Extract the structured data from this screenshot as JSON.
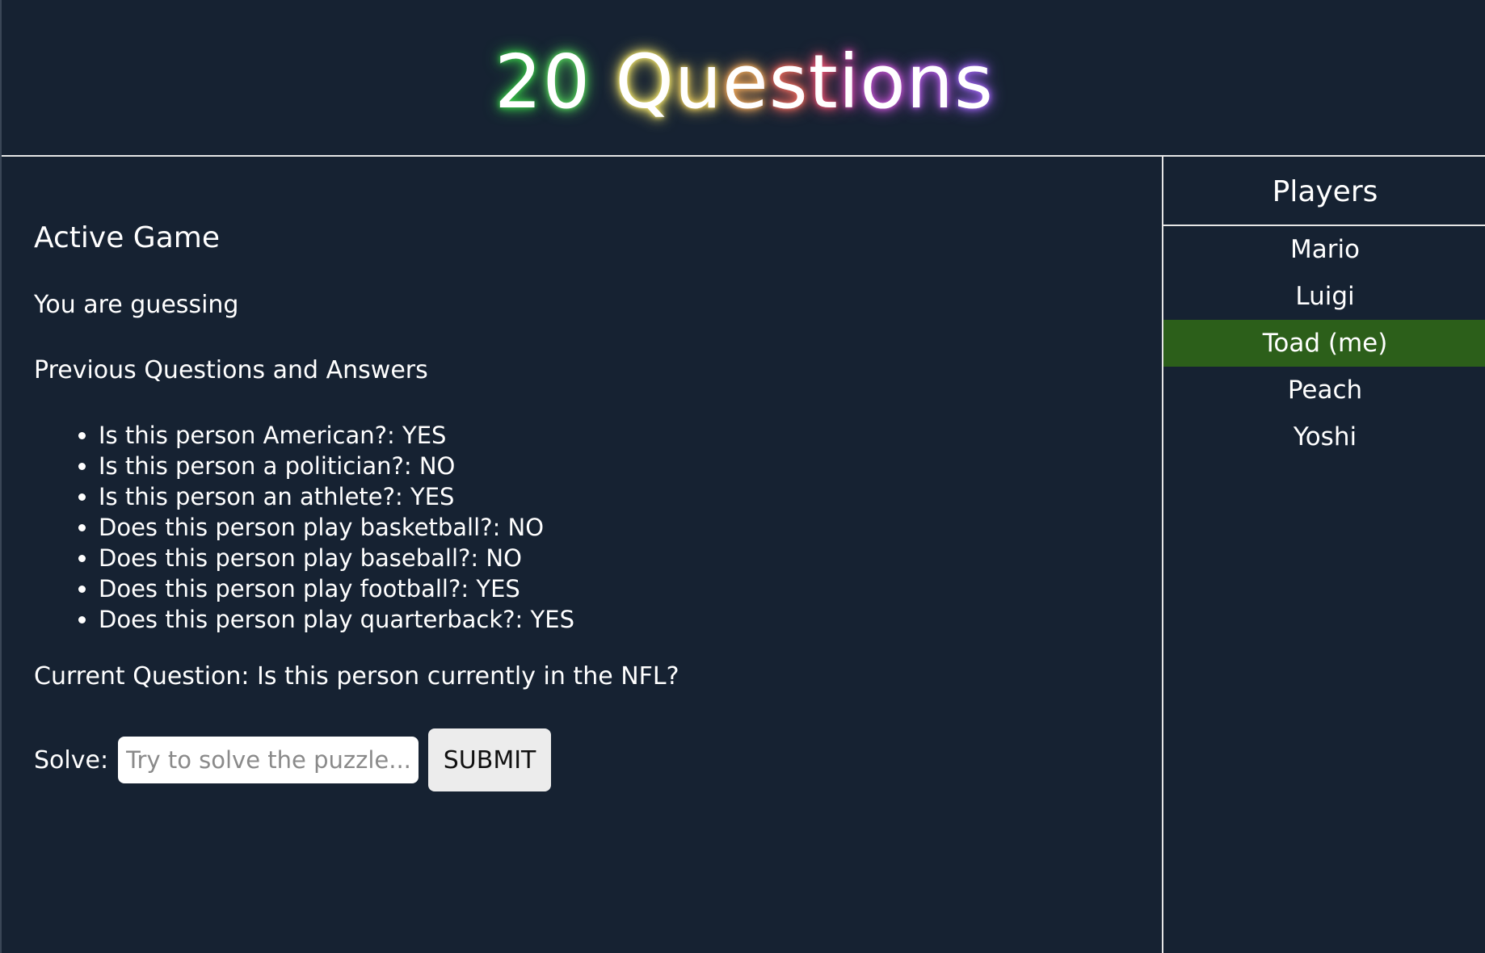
{
  "header": {
    "title_chars": [
      "2",
      "0",
      " ",
      "Q",
      "u",
      "e",
      "s",
      "t",
      "i",
      "o",
      "n",
      "s"
    ],
    "glow_colors": [
      "#38c548",
      "#53d05a",
      "#ffffff",
      "#f3e56b",
      "#f2d35f",
      "#f0a85a",
      "#ee6a5d",
      "#e45271",
      "#d14aa9",
      "#c454d3",
      "#b15ae1",
      "#9f63f0"
    ]
  },
  "main": {
    "section_title": "Active Game",
    "role_text": "You are guessing",
    "prev_title": "Previous Questions and Answers",
    "qa": [
      "Is this person American?: YES",
      "Is this person a politician?: NO",
      "Is this person an athlete?: YES",
      "Does this person play basketball?: NO",
      "Does this person play baseball?: NO",
      "Does this person play football?: YES",
      "Does this person play quarterback?: YES"
    ],
    "current_question": "Current Question: Is this person currently in the NFL?",
    "solve_label": "Solve:",
    "solve_placeholder": "Try to solve the puzzle...",
    "submit_label": "SUBMIT"
  },
  "sidebar": {
    "title": "Players",
    "players": [
      {
        "name": "Mario",
        "active": false
      },
      {
        "name": "Luigi",
        "active": false
      },
      {
        "name": "Toad (me)",
        "active": true
      },
      {
        "name": "Peach",
        "active": false
      },
      {
        "name": "Yoshi",
        "active": false
      }
    ],
    "active_color": "#2c5f1a"
  }
}
